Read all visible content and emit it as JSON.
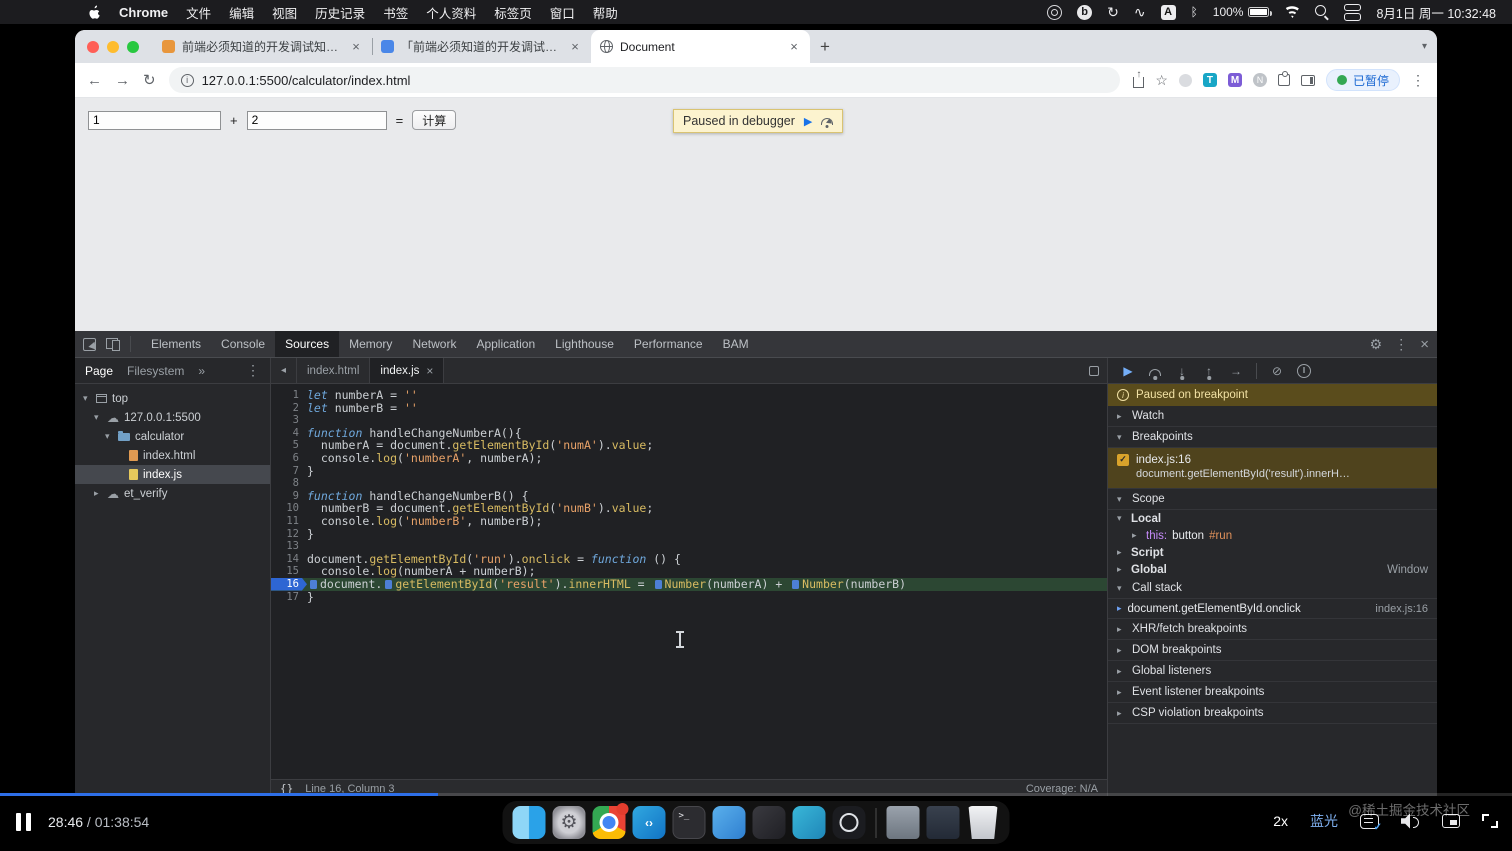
{
  "colors": {
    "accent_blue": "#1a73e8",
    "paused_banner_bg": "#5a4c1c",
    "breakpoint_checkbox_orange": "#d9a32b",
    "execution_line_green": "#2c4733",
    "progress_blue": "#2e6fe8",
    "record_badge_green": "#34a853"
  },
  "menubar": {
    "app": "Chrome",
    "menus": [
      "文件",
      "编辑",
      "视图",
      "历史记录",
      "书签",
      "个人资料",
      "标签页",
      "窗口",
      "帮助"
    ],
    "status_icons": [
      "screen-rec",
      "bilibili",
      "sync",
      "audio",
      "input-method",
      "bluetooth",
      "battery",
      "wifi",
      "search",
      "control-center"
    ],
    "battery": "100%",
    "datetime": "8月1日 周一  10:32:48"
  },
  "browser": {
    "tabs": [
      {
        "title": "前端必须知道的开发调试知识.pp",
        "favicon": "#e8963c",
        "active": false
      },
      {
        "title": "「前端必须知道的开发调试知识」",
        "favicon": "#4a87e8",
        "active": false
      },
      {
        "title": "Document",
        "favicon": "globe",
        "active": true
      }
    ],
    "url": "127.0.0.1:5500/calculator/index.html",
    "recording_badge": "已暂停"
  },
  "page": {
    "num_a": "1",
    "plus": "+",
    "num_b": "2",
    "equals": "=",
    "calc_button": "计算",
    "debugger_banner": "Paused in debugger"
  },
  "devtools": {
    "tabs": [
      "Elements",
      "Console",
      "Sources",
      "Memory",
      "Network",
      "Application",
      "Lighthouse",
      "Performance",
      "BAM"
    ],
    "active_tab": "Sources",
    "navigator": {
      "tabs": [
        "Page",
        "Filesystem"
      ],
      "more": "»",
      "tree": [
        {
          "label": "top",
          "depth": 0,
          "icon": "frame",
          "expander": "▾"
        },
        {
          "label": "127.0.0.1:5500",
          "depth": 1,
          "icon": "cloud",
          "expander": "▾"
        },
        {
          "label": "calculator",
          "depth": 2,
          "icon": "folder",
          "expander": "▾"
        },
        {
          "label": "index.html",
          "depth": 3,
          "icon": "file-html",
          "expander": ""
        },
        {
          "label": "index.js",
          "depth": 3,
          "icon": "file-js",
          "expander": "",
          "selected": true
        },
        {
          "label": "et_verify",
          "depth": 1,
          "icon": "cloud",
          "expander": "▸"
        }
      ]
    },
    "editor": {
      "tabs": [
        {
          "label": "index.html",
          "active": false
        },
        {
          "label": "index.js",
          "active": true,
          "closable": true
        }
      ],
      "active_line": 16,
      "lines": [
        [
          [
            "kw",
            "let"
          ],
          [
            "pl",
            " numberA = "
          ],
          [
            "st",
            "''"
          ]
        ],
        [
          [
            "kw",
            "let"
          ],
          [
            "pl",
            " numberB = "
          ],
          [
            "st",
            "''"
          ]
        ],
        [],
        [
          [
            "kw",
            "function"
          ],
          [
            "pl",
            " handleChangeNumberA(){"
          ]
        ],
        [
          [
            "pl",
            "  numberA = document."
          ],
          [
            "fn",
            "getElementById"
          ],
          [
            "pl",
            "("
          ],
          [
            "st",
            "'numA'"
          ],
          [
            "pl",
            ")."
          ],
          [
            "fn",
            "value"
          ],
          [
            "pl",
            ";"
          ]
        ],
        [
          [
            "pl",
            "  console."
          ],
          [
            "fn",
            "log"
          ],
          [
            "pl",
            "("
          ],
          [
            "st",
            "'numberA'"
          ],
          [
            "pl",
            ", numberA);"
          ]
        ],
        [
          [
            "pl",
            "}"
          ]
        ],
        [],
        [
          [
            "kw",
            "function"
          ],
          [
            "pl",
            " handleChangeNumberB() {"
          ]
        ],
        [
          [
            "pl",
            "  numberB = document."
          ],
          [
            "fn",
            "getElementById"
          ],
          [
            "pl",
            "("
          ],
          [
            "st",
            "'numB'"
          ],
          [
            "pl",
            ")."
          ],
          [
            "fn",
            "value"
          ],
          [
            "pl",
            ";"
          ]
        ],
        [
          [
            "pl",
            "  console."
          ],
          [
            "fn",
            "log"
          ],
          [
            "pl",
            "("
          ],
          [
            "st",
            "'numberB'"
          ],
          [
            "pl",
            ", numberB);"
          ]
        ],
        [
          [
            "pl",
            "}"
          ]
        ],
        [],
        [
          [
            "pl",
            "document."
          ],
          [
            "fn",
            "getElementById"
          ],
          [
            "pl",
            "("
          ],
          [
            "st",
            "'run'"
          ],
          [
            "pl",
            ")."
          ],
          [
            "fn",
            "onclick"
          ],
          [
            "pl",
            " = "
          ],
          [
            "kw",
            "function"
          ],
          [
            "pl",
            " () {"
          ]
        ],
        [
          [
            "pl",
            "  console."
          ],
          [
            "fn",
            "log"
          ],
          [
            "pl",
            "(numberA + numberB);"
          ]
        ],
        [
          [
            "mk",
            ""
          ],
          [
            "pl",
            "document."
          ],
          [
            "mk",
            ""
          ],
          [
            "fn",
            "getElementById"
          ],
          [
            "pl",
            "("
          ],
          [
            "st",
            "'result'"
          ],
          [
            "pl",
            ")."
          ],
          [
            "fn",
            "innerHTML"
          ],
          [
            "pl",
            " = "
          ],
          [
            "mk",
            ""
          ],
          [
            "fn",
            "Number"
          ],
          [
            "pl",
            "(numberA) + "
          ],
          [
            "mk",
            ""
          ],
          [
            "fn",
            "Number"
          ],
          [
            "pl",
            "(numberB)"
          ]
        ],
        [
          [
            "pl",
            "}"
          ]
        ]
      ],
      "status_left": "Line 16, Column 3",
      "status_right": "Coverage: N/A",
      "braces": "{}"
    },
    "debugger": {
      "paused_banner": "Paused on breakpoint",
      "watch_label": "Watch",
      "breakpoints_label": "Breakpoints",
      "breakpoint": {
        "location": "index.js:16",
        "snippet": "document.getElementById('result').innerH…"
      },
      "scope_label": "Scope",
      "scope": {
        "local_label": "Local",
        "this_key": "this: ",
        "this_tag": "button",
        "this_id": "#run",
        "script_label": "Script",
        "global_label": "Global",
        "global_value": "Window"
      },
      "callstack_label": "Call stack",
      "callstack": {
        "fn": "document.getElementById.onclick",
        "loc": "index.js:16"
      },
      "more_sections": [
        "XHR/fetch breakpoints",
        "DOM breakpoints",
        "Global listeners",
        "Event listener breakpoints",
        "CSP violation breakpoints"
      ]
    }
  },
  "player": {
    "time_current": "28:46",
    "time_rest": " / 01:38:54",
    "progress": 0.29,
    "speed": "2x",
    "quality": "蓝光",
    "controls": [
      "danmaku",
      "volume",
      "webfull",
      "full"
    ],
    "watermark": "@稀土掘金技术社区",
    "dock": [
      "finder",
      "settings",
      "chrome",
      "vscode",
      "terminal",
      "app-blue",
      "app-dark",
      "app-teal",
      "obs",
      "separator",
      "window-1",
      "window-2",
      "trash"
    ]
  }
}
